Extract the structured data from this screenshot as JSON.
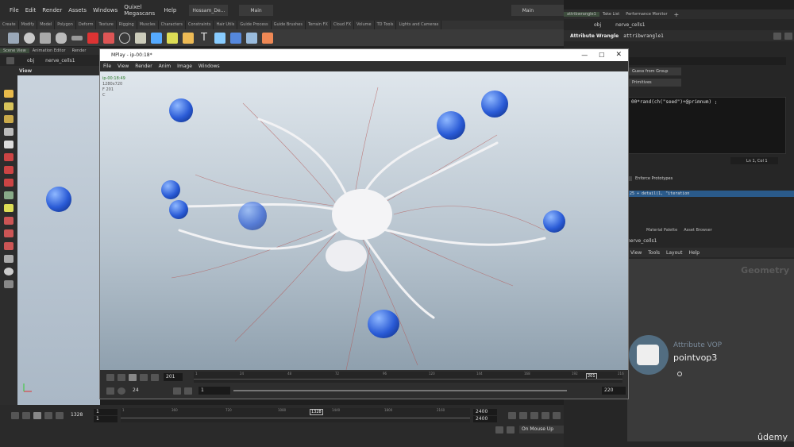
{
  "menubar": {
    "items": [
      "File",
      "Edit",
      "Render",
      "Assets",
      "Windows",
      "Quixel Megascans",
      "Help"
    ],
    "desktop": "Hossam_De...",
    "main_left": "Main",
    "main_right": "Main"
  },
  "shelf_tabs": [
    "Create",
    "Modify",
    "Model",
    "Polygon",
    "Deform",
    "Texture",
    "Rigging",
    "Muscles",
    "Characters",
    "Constraints",
    "Hair Utils",
    "Guide Process",
    "Guide Brushes",
    "Terrain FX",
    "Cloud FX",
    "Volume",
    "TD Tools",
    "Lights and Cameras"
  ],
  "pane_tabs_left": [
    "Scene View",
    "Animation Editor",
    "Render"
  ],
  "network_path": {
    "obj": "obj",
    "node": "nerve_cells1"
  },
  "view_label": "View",
  "mplay": {
    "title": "MPlay - ip-00:18*",
    "menu": [
      "File",
      "View",
      "Render",
      "Anim",
      "Image",
      "Windows"
    ],
    "overlay_lines": [
      "ip-00:18:49",
      "1280x720",
      "F 201",
      "C"
    ],
    "frame": "201",
    "fps": "24",
    "range_start": "1",
    "range_end": "220",
    "ruler_ticks": [
      "1",
      "24",
      "48",
      "72",
      "96",
      "120",
      "144",
      "168",
      "192",
      "216"
    ],
    "current_frame_marker": "201"
  },
  "right_panel": {
    "tabs": [
      "attribwrangle1",
      "Take List",
      "Performance Monitor"
    ],
    "path_obj": "obj",
    "path_node": "nerve_cells1",
    "node_type": "Attribute Wrangle",
    "node_name": "attribwrangle1",
    "group_type": "Guess from Group",
    "run_over": "Primitives",
    "code_line": "00*rand(ch(\"seed\")+@primnum) ;",
    "cursor_pos": "Ln 1, Col 1",
    "enforce_prototypes": "Enforce Prototypes",
    "expr_line": ".25 + detail(1, \"iteration",
    "lower_tabs": [
      "Material Palette",
      "Asset Browser"
    ],
    "lower_path_node": "nerve_cells1",
    "lower_menu": [
      "View",
      "Tools",
      "Layout",
      "Help"
    ],
    "geometry_label": "Geometry",
    "vop_type": "Attribute VOP",
    "vop_name": "pointvop3"
  },
  "timeline": {
    "frame": "1328",
    "start1": "1",
    "start2": "1",
    "ticks": [
      "1",
      "360",
      "720",
      "1080",
      "1440",
      "1800",
      "2160"
    ],
    "marker": "1328",
    "end1": "2400",
    "end2": "2400",
    "on_mouse_up": "On Mouse Up"
  },
  "watermark": "ûdemy",
  "colors": {
    "accent_blue": "#3d7bd9",
    "cells": "#2a5bd6",
    "neuron_white": "#f2f2f4",
    "dendrite_red": "#b5524f"
  }
}
